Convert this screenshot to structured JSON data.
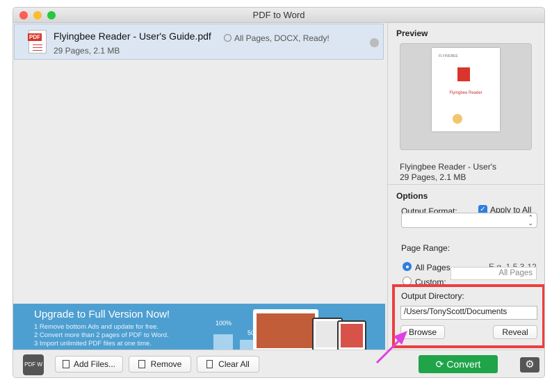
{
  "window": {
    "title": "PDF to Word"
  },
  "file": {
    "name": "Flyingbee Reader - User's Guide.pdf",
    "meta": "29 Pages, 2.1 MB",
    "status": "All Pages, DOCX, Ready!"
  },
  "banner": {
    "title": "Upgrade to Full Version Now!",
    "lines": [
      "1 Remove bottom Ads and update for free.",
      "2 Convert more than 2 pages of PDF to Word.",
      "3 Import unlimited PDF files at one time."
    ],
    "stat_100": "100%",
    "stat_50": "50"
  },
  "preview": {
    "heading": "Preview",
    "page_brand": "FLYINGBEE",
    "page_title": "Flyingbee Reader",
    "name": "Flyingbee Reader - User's",
    "meta": "29 Pages, 2.1 MB"
  },
  "options": {
    "heading": "Options",
    "output_format_label": "Output Format:",
    "apply_to_all": "Apply to All",
    "apply_checked": true,
    "format_value": "",
    "page_range_label": "Page Range:",
    "example": "E.g. 1,5,3-12",
    "all_pages": "All Pages",
    "custom": "Custom:",
    "custom_placeholder": "All Pages"
  },
  "output": {
    "label": "Output Directory:",
    "path": "/Users/TonyScott/Documents",
    "browse": "Browse",
    "reveal": "Reveal"
  },
  "toolbar": {
    "add_files": "Add Files...",
    "remove": "Remove",
    "clear_all": "Clear All",
    "convert": "Convert"
  },
  "colors": {
    "convert": "#1fa449",
    "highlight": "#ee3d3f",
    "arrow": "#e040e0",
    "banner": "#4e9fd1"
  }
}
